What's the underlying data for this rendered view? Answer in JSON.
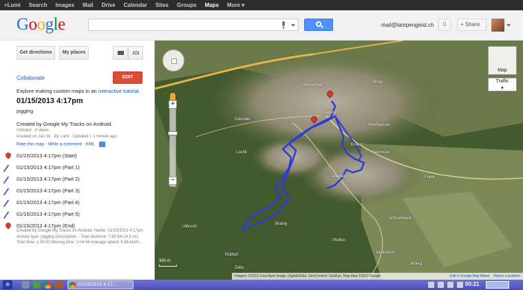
{
  "topbar": {
    "items": [
      "+Lumi",
      "Search",
      "Images",
      "Mail",
      "Drive",
      "Calendar",
      "Sites",
      "Groups",
      "Maps",
      "More ▾"
    ],
    "active": "Maps"
  },
  "header": {
    "logo": [
      "G",
      "o",
      "o",
      "g",
      "l",
      "e"
    ],
    "search_value": "",
    "email": "mail@lampengeist.ch",
    "notifications": "0",
    "share_label": "+ Share"
  },
  "panel": {
    "get_directions": "Get directions",
    "my_places": "My places",
    "collaborate": "Collaborate",
    "edit": "EDIT",
    "explore_text": "Explore making custom maps in an ",
    "explore_link": "interactive tutorial",
    "explore_end": ".",
    "map_title": "01/15/2013 4:17pm",
    "map_desc": "jogging",
    "created_by": "Created by Google My Tracks on Android.",
    "meta1": "Unlisted · 0 views",
    "meta2": "Created on Jan 16 · By Lumi · Updated < 1 minute ago",
    "links": "Rate this map · Write a comment · KML",
    "tracks": [
      {
        "label": "01/15/2013 4:17pm (Start)",
        "icon": "marker"
      },
      {
        "label": "01/15/2013 4:17pm (Part 1)",
        "icon": "line"
      },
      {
        "label": "01/15/2013 4:17pm (Part 2)",
        "icon": "line"
      },
      {
        "label": "01/15/2013 4:17pm (Part 3)",
        "icon": "line"
      },
      {
        "label": "01/15/2013 4:17pm (Part 4)",
        "icon": "line"
      },
      {
        "label": "01/15/2013 4:17pm (Part 5)",
        "icon": "line"
      },
      {
        "label": "01/15/2013 4:17pm (End)",
        "icon": "marker"
      }
    ],
    "end_desc": "Created by Google My Tracks on Android. Name: 01/15/2013 4:17pm Activity type: jogging Description: - Total distance: 7.95 km (4.9 mi) Total time: 1:09:42 Moving time: 1:04:44 Average speed: 6.85 km/h..."
  },
  "map": {
    "type_label": "Map",
    "traffic_label": "Traffic",
    "scale_label": "300 m",
    "attribution": "Imagery ©2013 Cnes/Spot Image, DigitalGlobe, GeoContent, GeoEye, Map data ©2013 Google",
    "edit_link": "Edit in Google Map Maker",
    "report_link": "Report a problem",
    "places": [
      "Strick",
      "Wiesenthal",
      "Gaisbühl",
      "Gänsitel",
      "Hochspeuel",
      "Enfeld",
      "Lochli",
      "Oberfeld",
      "Braing",
      "Pfeffen",
      "Ulbruch",
      "Rütihof",
      "Zella",
      "Jeberg",
      "Bemnstel",
      "Fuele",
      "Matterhof",
      "Schnenbach"
    ],
    "accent": "#2d3bd8"
  },
  "taskbar": {
    "task_label": "01/15/2013 4:17...",
    "clock": "00:21"
  }
}
